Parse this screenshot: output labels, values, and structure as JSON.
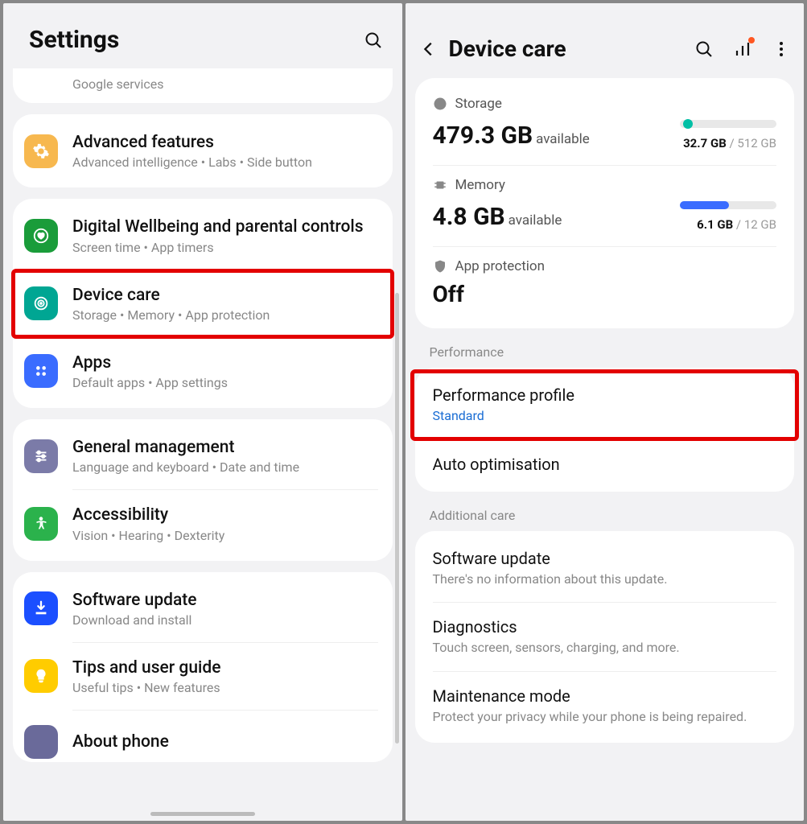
{
  "left": {
    "title": "Settings",
    "partial": "Google services",
    "items": [
      {
        "title": "Advanced features",
        "sub": "Advanced intelligence  •  Labs  •  Side button"
      },
      {
        "title": "Digital Wellbeing and parental controls",
        "sub": "Screen time  •  App timers"
      },
      {
        "title": "Device care",
        "sub": "Storage  •  Memory  •  App protection"
      },
      {
        "title": "Apps",
        "sub": "Default apps  •  App settings"
      },
      {
        "title": "General management",
        "sub": "Language and keyboard  •  Date and time"
      },
      {
        "title": "Accessibility",
        "sub": "Vision  •  Hearing  •  Dexterity"
      },
      {
        "title": "Software update",
        "sub": "Download and install"
      },
      {
        "title": "Tips and user guide",
        "sub": "Useful tips  •  New features"
      },
      {
        "title": "About phone",
        "sub": ""
      }
    ]
  },
  "right": {
    "title": "Device care",
    "storage": {
      "label": "Storage",
      "value": "479.3 GB",
      "suffix": "available",
      "used": "32.7 GB",
      "total": "512 GB",
      "pct": 6
    },
    "memory": {
      "label": "Memory",
      "value": "4.8 GB",
      "suffix": "available",
      "used": "6.1 GB",
      "total": "12 GB",
      "pct": 51
    },
    "app_protection": {
      "label": "App protection",
      "state": "Off"
    },
    "performance_section": "Performance",
    "perf_profile": {
      "title": "Performance profile",
      "value": "Standard"
    },
    "auto_opt": "Auto optimisation",
    "additional_section": "Additional care",
    "software": {
      "title": "Software update",
      "sub": "There's no information about this update."
    },
    "diag": {
      "title": "Diagnostics",
      "sub": "Touch screen, sensors, charging, and more."
    },
    "maint": {
      "title": "Maintenance mode",
      "sub": "Protect your privacy while your phone is being repaired."
    }
  }
}
